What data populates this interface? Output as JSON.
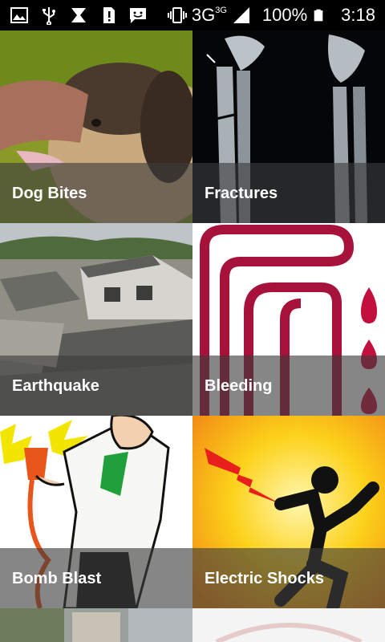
{
  "status_bar": {
    "network": "3G",
    "network_sup": "3G",
    "battery": "100%",
    "time": "3:18"
  },
  "tiles": [
    {
      "label": "Dog Bites"
    },
    {
      "label": "Fractures"
    },
    {
      "label": "Earthquake"
    },
    {
      "label": "Bleeding"
    },
    {
      "label": "Bomb Blast"
    },
    {
      "label": "Electric Shocks"
    }
  ]
}
